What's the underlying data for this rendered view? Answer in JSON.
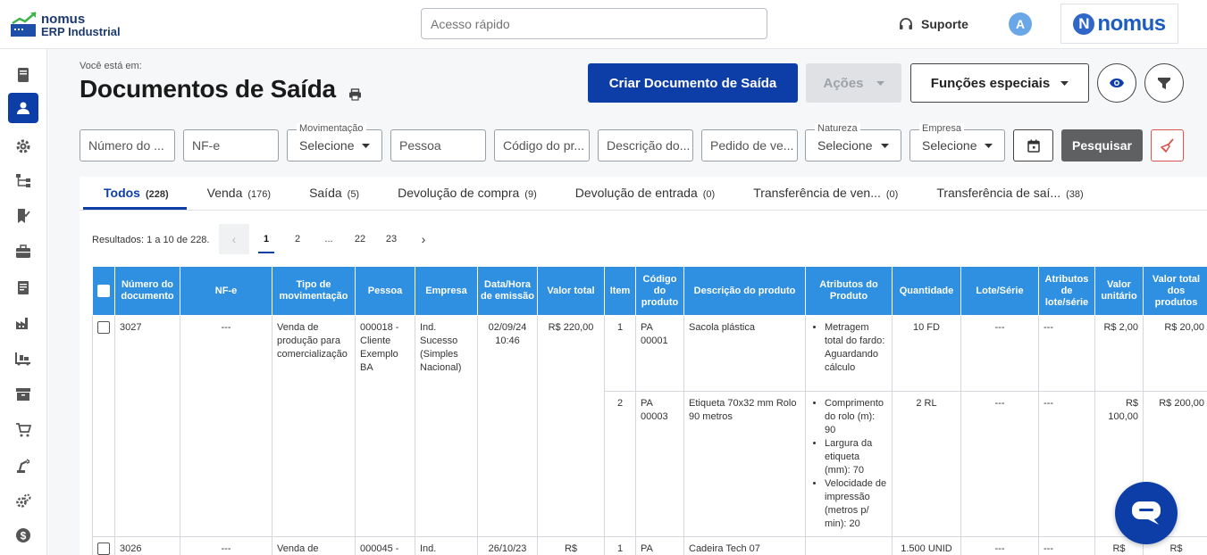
{
  "logo": {
    "line1": "nomus",
    "line2": "ERP Industrial"
  },
  "search": {
    "placeholder": "Acesso rápido"
  },
  "header": {
    "support_label": "Suporte",
    "avatar_initial": "A",
    "brand_letter": "N",
    "brand_text": "nomus"
  },
  "sidebar": {
    "items": [
      {
        "icon": "document-icon"
      },
      {
        "icon": "person-icon",
        "active": true
      },
      {
        "icon": "gear-icon"
      },
      {
        "icon": "hierarchy-icon"
      },
      {
        "icon": "bookmark-check-icon"
      },
      {
        "icon": "briefcase-icon"
      },
      {
        "icon": "clipboard-icon"
      },
      {
        "icon": "factory-icon"
      },
      {
        "icon": "pallet-icon"
      },
      {
        "icon": "archive-box-icon"
      },
      {
        "icon": "cart-icon"
      },
      {
        "icon": "robot-arm-icon"
      },
      {
        "icon": "gears-icon"
      },
      {
        "icon": "dollar-icon"
      }
    ]
  },
  "page": {
    "breadcrumb": "Você está em:",
    "title": "Documentos de Saída"
  },
  "actions": {
    "create": "Criar Documento de Saída",
    "acoes": "Ações",
    "especiais": "Funções especiais",
    "search_button": "Pesquisar"
  },
  "filters": {
    "numero": "Número do ...",
    "nfe": "NF-e",
    "movimentacao": {
      "label": "Movimentação",
      "value": "Selecione"
    },
    "pessoa": "Pessoa",
    "codigo": "Código do pr...",
    "descricao": "Descrição do...",
    "pedido": "Pedido de ve...",
    "natureza": {
      "label": "Natureza",
      "value": "Selecione"
    },
    "empresa": {
      "label": "Empresa",
      "value": "Selecione"
    }
  },
  "tabs": [
    {
      "label": "Todos",
      "count": "(228)"
    },
    {
      "label": "Venda",
      "count": "(176)"
    },
    {
      "label": "Saída",
      "count": "(5)"
    },
    {
      "label": "Devolução de compra",
      "count": "(9)"
    },
    {
      "label": "Devolução de entrada",
      "count": "(0)"
    },
    {
      "label": "Transferência de ven...",
      "count": "(0)"
    },
    {
      "label": "Transferência de saí...",
      "count": "(38)"
    }
  ],
  "pagination": {
    "results": "Resultados: 1 a 10 de 228.",
    "prev": "‹",
    "p1": "1",
    "p2": "2",
    "ellipsis": "...",
    "p22": "22",
    "p23": "23",
    "next": "›"
  },
  "table": {
    "headers": [
      "Número do documento",
      "NF-e",
      "Tipo de movimentação",
      "Pessoa",
      "Empresa",
      "Data/Hora de emissão",
      "Valor total",
      "Item",
      "Código do produto",
      "Descrição do produto",
      "Atributos do Produto",
      "Quantidade",
      "Lote/Série",
      "Atributos de lote/série",
      "Valor unitário",
      "Valor total dos produtos"
    ],
    "doc1": {
      "numero": "3027",
      "nfe": "---",
      "tipo": "Venda de produção para comercialização",
      "pessoa": "000018 - Cliente Exemplo BA",
      "empresa": "Ind. Sucesso (Simples Nacional)",
      "data": "02/09/24 10:46",
      "valor": "R$ 220,00",
      "items": [
        {
          "item": "1",
          "codigo": "PA 00001",
          "descricao": "Sacola plástica",
          "attrs": [
            "Metragem total do fardo: Aguardando cálculo"
          ],
          "qtd": "10 FD",
          "lote": "---",
          "lattr": "---",
          "unit": "R$ 2,00",
          "total": "R$ 20,00"
        },
        {
          "item": "2",
          "codigo": "PA 00003",
          "descricao": "Etiqueta 70x32 mm Rolo 90 metros",
          "attrs": [
            "Comprimento do rolo (m): 90",
            "Largura da etiqueta (mm): 70",
            "Velocidade de impressão (metros p/ min): 20"
          ],
          "qtd": "2 RL",
          "lote": "---",
          "lattr": "---",
          "unit": "R$ 100,00",
          "total": "R$ 200,00"
        }
      ]
    },
    "doc2": {
      "numero": "3026",
      "nfe": "---",
      "tipo": "Venda de",
      "pessoa": "000045 -",
      "empresa": "Ind.",
      "data": "26/10/23",
      "valor": "R$",
      "item": "1",
      "codigo": "PA",
      "descricao": "Cadeira Tech 07",
      "qtd": "1.500 UNID",
      "lote": "---",
      "lattr": "---",
      "unit": "R$",
      "total": "R$"
    }
  },
  "colors": {
    "primary": "#0d3ea8",
    "header_blue": "#2f8fe0",
    "disabled": "#dfe1e5",
    "search_btn": "#5f6062"
  }
}
